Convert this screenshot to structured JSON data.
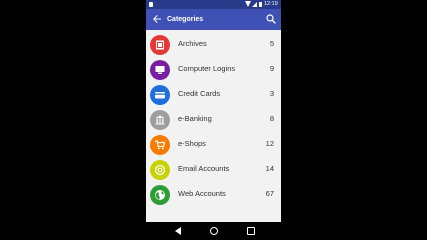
{
  "status_bar": {
    "time": "12:19"
  },
  "app_bar": {
    "title": "Categories"
  },
  "categories": [
    {
      "label": "Archives",
      "count": "5",
      "icon": "archive-icon",
      "color": "#e53935"
    },
    {
      "label": "Computer Logins",
      "count": "9",
      "icon": "computer-icon",
      "color": "#7b1fa2"
    },
    {
      "label": "Credit Cards",
      "count": "3",
      "icon": "credit-card-icon",
      "color": "#1e6fd9"
    },
    {
      "label": "e-Banking",
      "count": "8",
      "icon": "bank-icon",
      "color": "#9e9e9e"
    },
    {
      "label": "e-Shops",
      "count": "12",
      "icon": "cart-icon",
      "color": "#f57c00"
    },
    {
      "label": "Email Accounts",
      "count": "14",
      "icon": "email-icon",
      "color": "#c6d300"
    },
    {
      "label": "Web Accounts",
      "count": "67",
      "icon": "globe-icon",
      "color": "#2e9d37"
    }
  ]
}
